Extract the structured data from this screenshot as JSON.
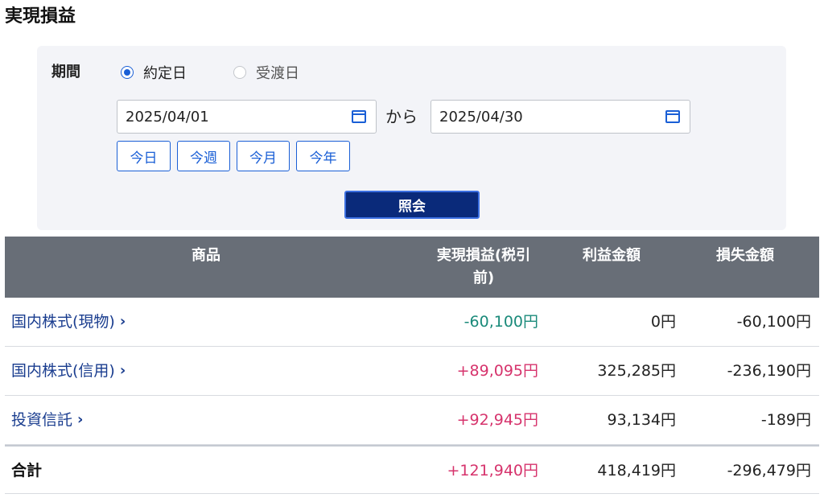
{
  "page_title": "実現損益",
  "filter": {
    "period_label": "期間",
    "radio_options": [
      {
        "label": "約定日",
        "checked": true
      },
      {
        "label": "受渡日",
        "checked": false
      }
    ],
    "date_from": "2025/04/01",
    "date_to": "2025/04/30",
    "separator": "から",
    "quick_buttons": [
      "今日",
      "今週",
      "今月",
      "今年"
    ],
    "search_label": "照会"
  },
  "table": {
    "headers": {
      "product": "商品",
      "realized": "実現損益(税引前)",
      "realized_line1": "実現損益(税引",
      "realized_line2": "前)",
      "profit": "利益金額",
      "loss": "損失金額"
    },
    "rows": [
      {
        "name": "国内株式(現物)",
        "realized": "-60,100円",
        "profit": "0円",
        "loss": "-60,100円",
        "sign": "neg"
      },
      {
        "name": "国内株式(信用)",
        "realized": "+89,095円",
        "profit": "325,285円",
        "loss": "-236,190円",
        "sign": "pos"
      },
      {
        "name": "投資信託",
        "realized": "+92,945円",
        "profit": "93,134円",
        "loss": "-189円",
        "sign": "pos"
      }
    ],
    "total": {
      "name": "合計",
      "realized": "+121,940円",
      "profit": "418,419円",
      "loss": "-296,479円",
      "sign": "pos"
    }
  },
  "icons": {
    "calendar": "calendar-icon",
    "chevron": "chevron-right-icon"
  },
  "colors": {
    "accent": "#1a5fd6",
    "button_dark": "#0a2a7a",
    "header_bg": "#686e77",
    "negative": "#1a8a7a",
    "positive": "#d6336c"
  }
}
